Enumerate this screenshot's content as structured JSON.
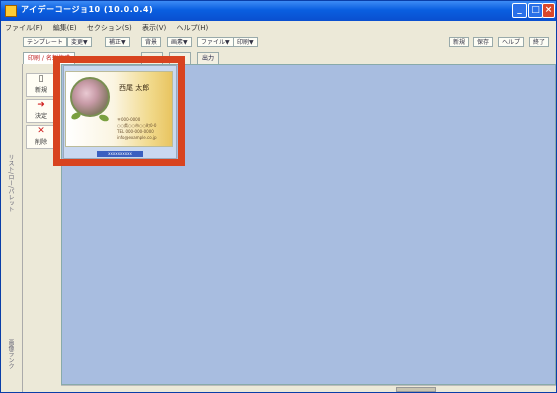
{
  "window": {
    "title": "アイデーコージョ10 (10.0.0.4)",
    "controls": {
      "minimize": "_",
      "maximize": "□",
      "close": "×"
    }
  },
  "menu": [
    "ファイル(F)",
    "編集(E)",
    "セクション(S)",
    "表示(V)",
    "ヘルプ(H)"
  ],
  "toolbar": {
    "left": [
      "テンプレート",
      "変更▼",
      "補正▼",
      "背景",
      "画素▼",
      "ファイル▼",
      "印刷▼"
    ],
    "right": [
      "新規",
      "保存",
      "ヘルプ",
      "終了"
    ]
  },
  "tabs": [
    {
      "label": "印刷 / 名刺作成",
      "active": true
    },
    {
      "label": ""
    },
    {
      "label": ""
    },
    {
      "label": "出力"
    }
  ],
  "side_buttons": [
    {
      "icon": "new-doc-icon",
      "glyph": "▯",
      "label": "新規"
    },
    {
      "icon": "arrow-right-icon",
      "glyph": "➜",
      "label": "決定"
    },
    {
      "icon": "delete-x-icon",
      "glyph": "✕",
      "label": "削除"
    }
  ],
  "left_labels": {
    "top": "リスト/ロー/パレット",
    "bottom": "画像ランク"
  },
  "card": {
    "name": "西尾 太郎",
    "lines": [
      "〒000-0000",
      "○○県○○市○○町0-0",
      "TEL 000-000-0000",
      "info@example.co.jp"
    ],
    "id_label": "xxxxxxxxxx"
  },
  "colors": {
    "title_bar": "#0a5fe0",
    "highlight_frame": "#d8431f",
    "canvas": "#a8bde0"
  }
}
